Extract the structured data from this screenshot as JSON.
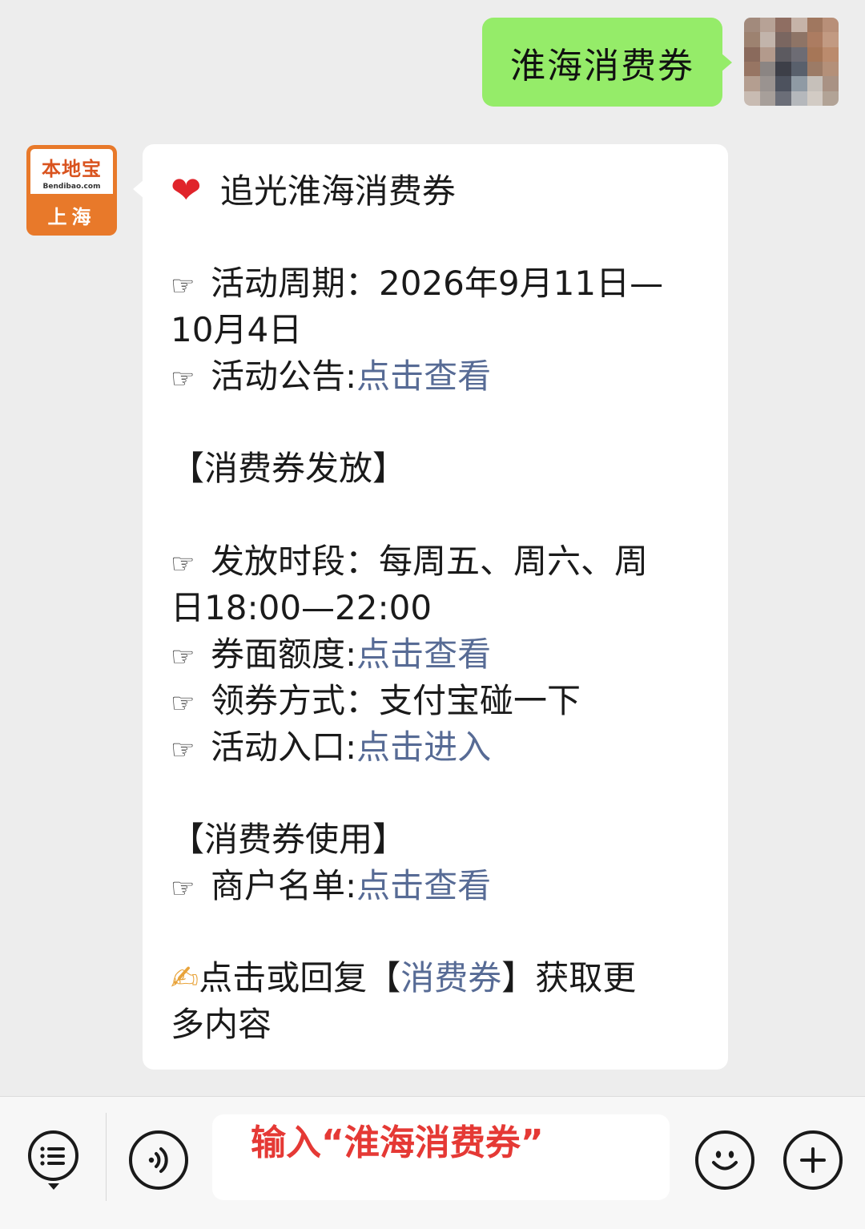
{
  "outgoing_message": {
    "text": "淮海消费券"
  },
  "bot": {
    "avatar_brand": "本地宝",
    "avatar_domain": "Bendibao.com",
    "avatar_city": "上海"
  },
  "message": {
    "title_emoji": "❤",
    "title": "追光淮海消费券",
    "pointer": "☞",
    "period_label": "活动周期：",
    "period_value_1": "2026年9月11日—",
    "period_value_2": "10月4日",
    "notice_label": "活动公告:",
    "notice_link": "点击查看",
    "section_issue": "【消费券发放】",
    "time_label": "发放时段：",
    "time_value_1": "每周五、周六、周",
    "time_value_2": "日18:00—22:00",
    "amount_label": "券面额度:",
    "amount_link": "点击查看",
    "method_label": "领券方式：",
    "method_value": "支付宝碰一下",
    "entry_label": "活动入口:",
    "entry_link": "点击进入",
    "section_use": "【消费券使用】",
    "merchant_label": "商户名单:",
    "merchant_link": "点击查看",
    "footer_emoji": "✍",
    "footer_pre": "点击或回复【",
    "footer_link": "消费券",
    "footer_post_1": "】获取更",
    "footer_post_2": "多内容"
  },
  "input_bar": {
    "input_text": "输入“淮海消费券”",
    "icons": [
      "menu-list-icon",
      "voice-icon",
      "emoji-icon",
      "plus-icon"
    ]
  },
  "colors": {
    "outgoing_bubble": "#95ec69",
    "link": "#576b95",
    "input_hint": "#e53935",
    "brand_orange": "#e8792a"
  }
}
